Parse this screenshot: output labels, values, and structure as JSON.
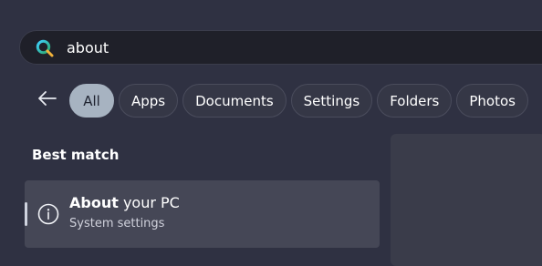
{
  "search": {
    "value": "about",
    "icon": "search-icon"
  },
  "filters": {
    "back_icon": "back-arrow-icon",
    "items": [
      {
        "label": "All",
        "active": true
      },
      {
        "label": "Apps",
        "active": false
      },
      {
        "label": "Documents",
        "active": false
      },
      {
        "label": "Settings",
        "active": false
      },
      {
        "label": "Folders",
        "active": false
      },
      {
        "label": "Photos",
        "active": false
      }
    ]
  },
  "best_match": {
    "title": "Best match",
    "result": {
      "icon": "info-icon",
      "title_bold": "About",
      "title_rest": " your PC",
      "subtitle": "System settings"
    }
  },
  "colors": {
    "background": "#2f3142",
    "search_box": "#1f2029",
    "active_chip": "#a7b3c1",
    "selected_result": "#454756"
  }
}
